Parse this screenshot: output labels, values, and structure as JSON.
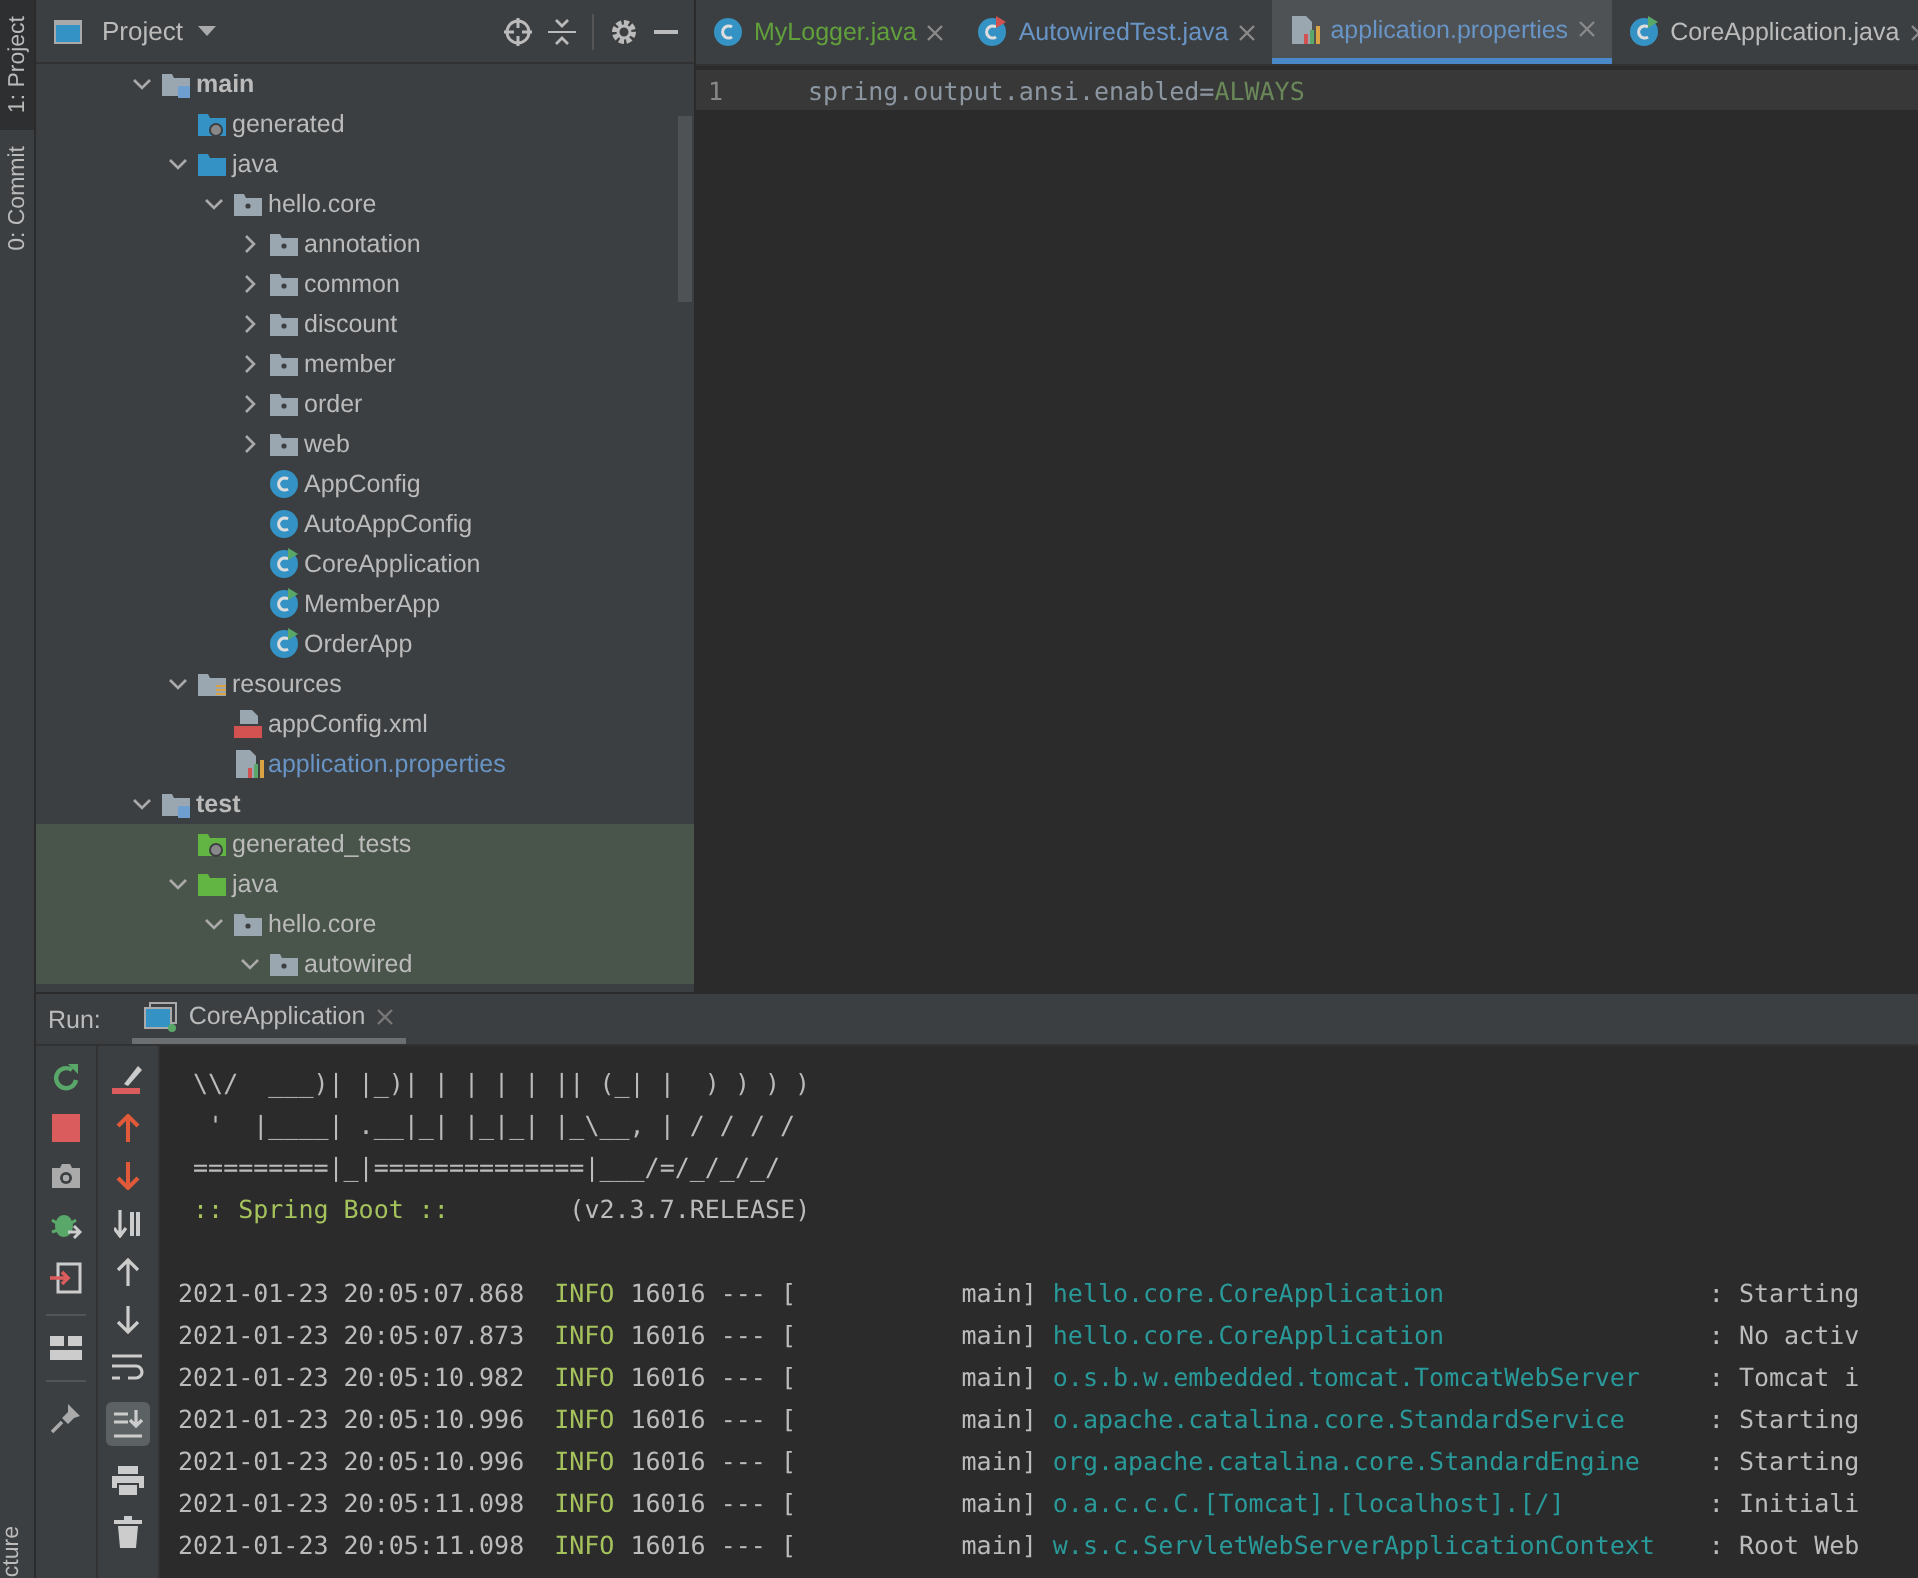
{
  "side_stripe": {
    "tabs": [
      {
        "label": "1: Project",
        "selected": true
      },
      {
        "label": "0: Commit",
        "selected": false
      }
    ],
    "bottom_label": "cture"
  },
  "project_panel": {
    "title": "Project",
    "tree": [
      {
        "label": "main",
        "kind": "module",
        "expanded": true,
        "highlighted": false,
        "color": "#bbbbbb",
        "children": [
          {
            "label": "generated",
            "kind": "generated-folder",
            "highlighted": false,
            "color": "#bbbbbb"
          },
          {
            "label": "java",
            "kind": "source-folder",
            "expanded": true,
            "highlighted": false,
            "color": "#bbbbbb",
            "children": [
              {
                "label": "hello.core",
                "kind": "package",
                "expanded": true,
                "highlighted": false,
                "color": "#bbbbbb",
                "children": [
                  {
                    "label": "annotation",
                    "kind": "package",
                    "expanded": false,
                    "highlighted": false,
                    "color": "#bbbbbb"
                  },
                  {
                    "label": "common",
                    "kind": "package",
                    "expanded": false,
                    "highlighted": false,
                    "color": "#bbbbbb"
                  },
                  {
                    "label": "discount",
                    "kind": "package",
                    "expanded": false,
                    "highlighted": false,
                    "color": "#bbbbbb"
                  },
                  {
                    "label": "member",
                    "kind": "package",
                    "expanded": false,
                    "highlighted": false,
                    "color": "#bbbbbb"
                  },
                  {
                    "label": "order",
                    "kind": "package",
                    "expanded": false,
                    "highlighted": false,
                    "color": "#bbbbbb"
                  },
                  {
                    "label": "web",
                    "kind": "package",
                    "expanded": false,
                    "highlighted": false,
                    "color": "#bbbbbb"
                  },
                  {
                    "label": "AppConfig",
                    "kind": "class",
                    "highlighted": false,
                    "color": "#bbbbbb"
                  },
                  {
                    "label": "AutoAppConfig",
                    "kind": "class",
                    "highlighted": false,
                    "color": "#bbbbbb"
                  },
                  {
                    "label": "CoreApplication",
                    "kind": "main-class",
                    "highlighted": false,
                    "color": "#bbbbbb"
                  },
                  {
                    "label": "MemberApp",
                    "kind": "main-class",
                    "highlighted": false,
                    "color": "#bbbbbb"
                  },
                  {
                    "label": "OrderApp",
                    "kind": "main-class",
                    "highlighted": false,
                    "color": "#bbbbbb"
                  }
                ]
              }
            ]
          },
          {
            "label": "resources",
            "kind": "resources-folder",
            "expanded": true,
            "highlighted": false,
            "color": "#bbbbbb",
            "children": [
              {
                "label": "appConfig.xml",
                "kind": "xml-file",
                "highlighted": false,
                "color": "#bbbbbb"
              },
              {
                "label": "application.properties",
                "kind": "properties-file",
                "highlighted": false,
                "color": "#6894c6"
              }
            ]
          }
        ]
      },
      {
        "label": "test",
        "kind": "module",
        "expanded": true,
        "highlighted": false,
        "color": "#bbbbbb",
        "children": [
          {
            "label": "generated_tests",
            "kind": "test-generated-folder",
            "highlighted": true,
            "color": "#bbbbbb"
          },
          {
            "label": "java",
            "kind": "test-source-folder",
            "expanded": true,
            "highlighted": true,
            "color": "#bbbbbb",
            "children": [
              {
                "label": "hello.core",
                "kind": "package",
                "expanded": true,
                "highlighted": true,
                "color": "#bbbbbb",
                "children": [
                  {
                    "label": "autowired",
                    "kind": "package",
                    "expanded": true,
                    "highlighted": true,
                    "color": "#bbbbbb"
                  }
                ]
              }
            ]
          }
        ]
      }
    ]
  },
  "editor": {
    "tabs": [
      {
        "label": "MyLogger.java",
        "kind": "class",
        "selected": false,
        "color": "#62a03c"
      },
      {
        "label": "AutowiredTest.java",
        "kind": "test-class",
        "selected": false,
        "color": "#6894c6"
      },
      {
        "label": "application.properties",
        "kind": "properties-file",
        "selected": true,
        "color": "#6894c6"
      },
      {
        "label": "CoreApplication.java",
        "kind": "main-class",
        "selected": false,
        "color": "#bbbbbb"
      }
    ],
    "lines": [
      {
        "number": "1",
        "key": "spring.output.ansi.enabled=",
        "value": "ALWAYS",
        "current": true
      }
    ]
  },
  "run_panel": {
    "label": "Run:",
    "tabs": [
      {
        "label": "CoreApplication",
        "selected": true
      }
    ],
    "scroll_to_end_on": true,
    "banner": [
      {
        "kind": "art",
        "text": " \\\\/  ___)| |_)| | | | | || (_| |  ) ) ) )"
      },
      {
        "kind": "art",
        "text": "  '  |____| .__|_| |_|_| |_\\__, | / / / /"
      },
      {
        "kind": "art",
        "text": " =========|_|==============|___/=/_/_/_/"
      },
      {
        "kind": "version",
        "label": " :: Spring Boot :: ",
        "text": "       (v2.3.7.RELEASE)"
      },
      {
        "kind": "blank"
      }
    ],
    "log": [
      {
        "time": "2021-01-23 20:05:07.868",
        "level": "INFO",
        "process": "16016 --- [           main]",
        "logger": "hello.core.CoreApplication",
        "message": ": Starting"
      },
      {
        "time": "2021-01-23 20:05:07.873",
        "level": "INFO",
        "process": "16016 --- [           main]",
        "logger": "hello.core.CoreApplication",
        "message": ": No activ"
      },
      {
        "time": "2021-01-23 20:05:10.982",
        "level": "INFO",
        "process": "16016 --- [           main]",
        "logger": "o.s.b.w.embedded.tomcat.TomcatWebServer",
        "message": ": Tomcat i"
      },
      {
        "time": "2021-01-23 20:05:10.996",
        "level": "INFO",
        "process": "16016 --- [           main]",
        "logger": "o.apache.catalina.core.StandardService",
        "message": ": Starting"
      },
      {
        "time": "2021-01-23 20:05:10.996",
        "level": "INFO",
        "process": "16016 --- [           main]",
        "logger": "org.apache.catalina.core.StandardEngine",
        "message": ": Starting"
      },
      {
        "time": "2021-01-23 20:05:11.098",
        "level": "INFO",
        "process": "16016 --- [           main]",
        "logger": "o.a.c.c.C.[Tomcat].[localhost].[/]",
        "message": ": Initiali"
      },
      {
        "time": "2021-01-23 20:05:11.098",
        "level": "INFO",
        "process": "16016 --- [           main]",
        "logger": "w.s.c.ServletWebServerApplicationContext",
        "message": ": Root Web"
      }
    ]
  }
}
